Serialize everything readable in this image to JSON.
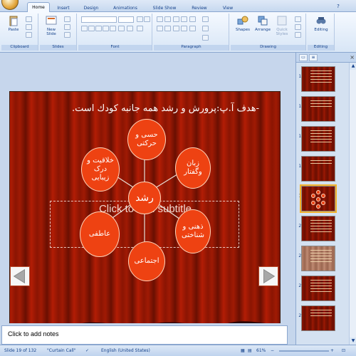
{
  "ribbon": {
    "tabs": [
      "Home",
      "Insert",
      "Design",
      "Animations",
      "Slide Show",
      "Review",
      "View"
    ],
    "groups": {
      "clipboard": {
        "label": "Clipboard",
        "paste": "Paste"
      },
      "slides": {
        "label": "Slides",
        "new_slide": "New Slide"
      },
      "font": {
        "label": "Font"
      },
      "paragraph": {
        "label": "Paragraph"
      },
      "drawing": {
        "label": "Drawing",
        "shapes": "Shapes",
        "arrange": "Arrange",
        "quick_styles": "Quick Styles"
      },
      "editing": {
        "label": "Editing",
        "editing": "Editing"
      }
    }
  },
  "slide": {
    "title": "-هدف آ.پ:پرورش و رشد همه جانبه كودك است.",
    "placeholder": "Click to add subtitle",
    "nodes": {
      "center": "رشد",
      "top": "حسی و حرکتی",
      "top_right": "زبان وگفتار",
      "top_left": "خلاقیت و درک زیبایی",
      "bottom_right": "ذهنی و شناختی",
      "bottom_left": "عاطفی",
      "bottom": "اجتماعی"
    }
  },
  "thumbnails": [
    "15",
    "16",
    "17",
    "18",
    "19",
    "20",
    "21",
    "22",
    "23",
    "24"
  ],
  "selected_slide": "19",
  "notes": {
    "placeholder": "Click to add notes"
  },
  "status": {
    "slide": "Slide 19 of 132",
    "theme": "\"Curtain Call\"",
    "language": "English (United States)",
    "zoom": "61%"
  }
}
